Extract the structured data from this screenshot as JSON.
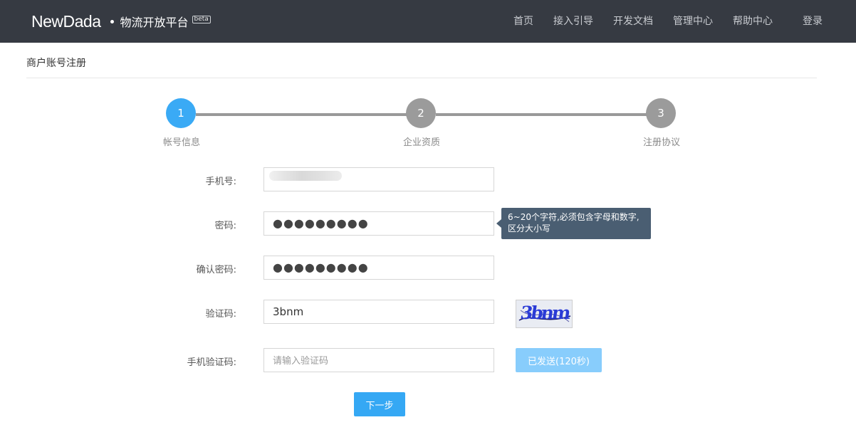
{
  "header": {
    "logo_text": "NewDada",
    "platform_name": "物流开放平台",
    "beta_badge": "beta",
    "nav": [
      {
        "label": "首页"
      },
      {
        "label": "接入引导"
      },
      {
        "label": "开发文档"
      },
      {
        "label": "管理中心"
      },
      {
        "label": "帮助中心"
      }
    ],
    "login_label": "登录"
  },
  "page": {
    "title": "商户账号注册"
  },
  "steps": [
    {
      "number": "1",
      "label": "帐号信息",
      "status": "active",
      "color": "#3aaaf5"
    },
    {
      "number": "2",
      "label": "企业资质",
      "status": "pending",
      "color": "#9b9b9b"
    },
    {
      "number": "3",
      "label": "注册协议",
      "status": "pending",
      "color": "#9b9b9b"
    }
  ],
  "form": {
    "phone": {
      "label": "手机号:",
      "value": ""
    },
    "password": {
      "label": "密码:",
      "value": "●●●●●●●●●"
    },
    "password_tip": "6~20个字符,必须包含字母和数字,区分大小写",
    "confirm_password": {
      "label": "确认密码:",
      "value": "●●●●●●●●●"
    },
    "captcha": {
      "label": "验证码:",
      "value": "3bnm",
      "image_text": "3bnm"
    },
    "sms_code": {
      "label": "手机验证码:",
      "placeholder": "请输入验证码",
      "value": ""
    },
    "sms_button_label": "已发送(120秒)",
    "next_button_label": "下一步"
  },
  "colors": {
    "header_bg": "#363a42",
    "primary": "#35a8f4",
    "primary_disabled": "#88cdfc",
    "tooltip_bg": "#4a5e72",
    "step_inactive": "#9b9b9b"
  }
}
